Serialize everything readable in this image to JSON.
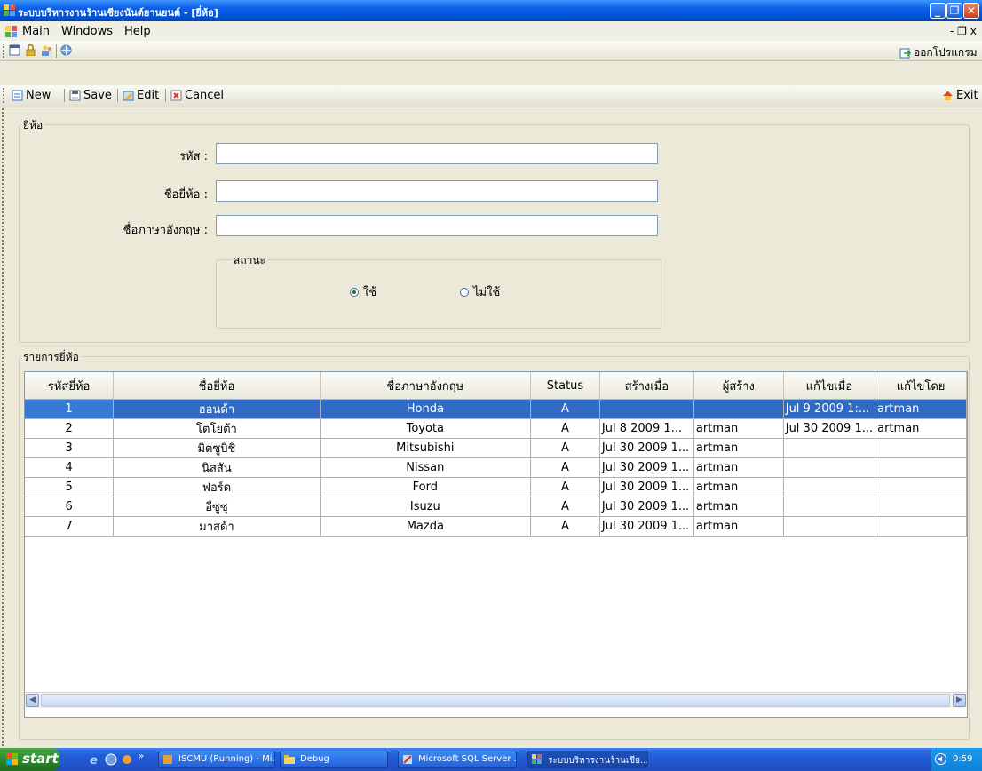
{
  "window": {
    "title": "ระบบบริหารงานร้านเชียงนันต์ยานยนต์ - [ยี่ห้อ]",
    "minimize_label": "_",
    "maximize_label": "❐",
    "close_label": "✕",
    "mdi_controls": "- ❐ x"
  },
  "menu": {
    "items": [
      "Main",
      "Windows",
      "Help"
    ]
  },
  "toolbar1": {
    "exit_program_label": "ออกโปรแกรม"
  },
  "toolbar2": {
    "new_label": "New",
    "save_label": "Save",
    "edit_label": "Edit",
    "cancel_label": "Cancel",
    "exit_label": "Exit"
  },
  "form": {
    "group_label": "ยี่ห้อ",
    "code_label": "รหัส :",
    "code_value": "",
    "name_label": "ชื่อยี่ห้อ :",
    "name_value": "",
    "english_label": "ชื่อภาษาอังกฤษ :",
    "english_value": "",
    "status_group_label": "สถานะ",
    "status_options": [
      "ใช้",
      "ไม่ใช้"
    ],
    "status_selected": "ใช้"
  },
  "list": {
    "group_label": "รายการยี่ห้อ",
    "columns": [
      "รหัสยี่ห้อ",
      "ชื่อยี่ห้อ",
      "ชื่อภาษาอังกฤษ",
      "Status",
      "สร้างเมื่อ",
      "ผู้สร้าง",
      "แก้ไขเมื่อ",
      "แก้ไขโดย"
    ],
    "rows": [
      [
        "1",
        "ฮอนด้า",
        "Honda",
        "A",
        "",
        "",
        "Jul 9 2009 1:...",
        "artman"
      ],
      [
        "2",
        "โตโยต้า",
        "Toyota",
        "A",
        "Jul 8 2009 1...",
        "artman",
        "Jul 30 2009 1...",
        "artman"
      ],
      [
        "3",
        "มิตซูบิชิ",
        "Mitsubishi",
        "A",
        "Jul 30 2009 1...",
        "artman",
        "",
        ""
      ],
      [
        "4",
        "นิสสัน",
        "Nissan",
        "A",
        "Jul 30 2009 1...",
        "artman",
        "",
        ""
      ],
      [
        "5",
        "ฟอร์ด",
        "Ford",
        "A",
        "Jul 30 2009 1...",
        "artman",
        "",
        ""
      ],
      [
        "6",
        "อีซูซุ",
        "Isuzu",
        "A",
        "Jul 30 2009 1...",
        "artman",
        "",
        ""
      ],
      [
        "7",
        "มาสด้า",
        "Mazda",
        "A",
        "Jul 30 2009 1...",
        "artman",
        "",
        ""
      ]
    ],
    "selected_row": 0
  },
  "taskbar": {
    "start_label": "start",
    "tasks": [
      "ISCMU (Running) - Mi...",
      "Debug",
      "Microsoft SQL Server ...",
      "ระบบบริหารงานร้านเชีย..."
    ],
    "clock": "0:59"
  },
  "colors": {
    "titlebar": "#0a5fe6",
    "selection": "#316ac5",
    "taskbar": "#245edb",
    "start": "#2b8a2b"
  }
}
